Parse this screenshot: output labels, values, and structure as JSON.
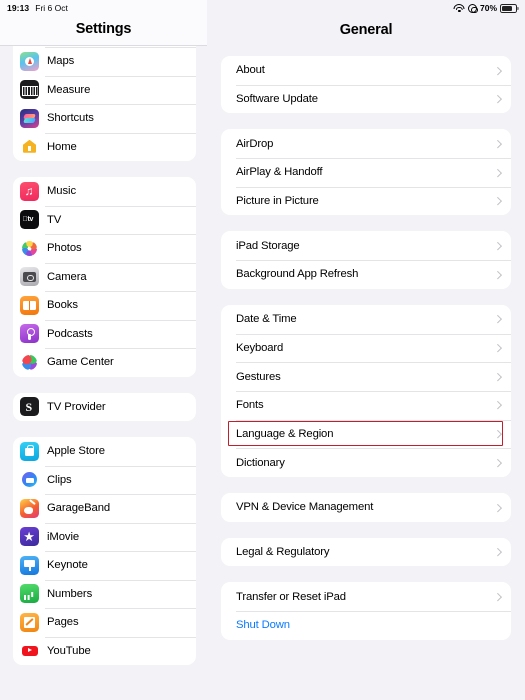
{
  "status_bar": {
    "time": "19:13",
    "date": "Fri 6 Oct",
    "wifi_icon": "wifi-icon",
    "location_icon": "location-icon",
    "battery_percent": "70%",
    "battery_icon": "battery-icon",
    "battery_level": 70
  },
  "sidebar": {
    "title": "Settings",
    "groups": [
      {
        "clipped_top": true,
        "items": [
          {
            "label": "Maps",
            "icon": "maps-app-icon",
            "icon_class": "ic-maps"
          },
          {
            "label": "Measure",
            "icon": "measure-app-icon",
            "icon_class": "ic-measure"
          },
          {
            "label": "Shortcuts",
            "icon": "shortcuts-app-icon",
            "icon_class": "ic-shortcuts"
          },
          {
            "label": "Home",
            "icon": "home-app-icon",
            "icon_class": "ic-home"
          }
        ]
      },
      {
        "clipped_top": false,
        "items": [
          {
            "label": "Music",
            "icon": "music-app-icon",
            "icon_class": "ic-music"
          },
          {
            "label": "TV",
            "icon": "tv-app-icon",
            "icon_class": "ic-tv"
          },
          {
            "label": "Photos",
            "icon": "photos-app-icon",
            "icon_class": "ic-photos"
          },
          {
            "label": "Camera",
            "icon": "camera-app-icon",
            "icon_class": "ic-camera"
          },
          {
            "label": "Books",
            "icon": "books-app-icon",
            "icon_class": "ic-books"
          },
          {
            "label": "Podcasts",
            "icon": "podcasts-app-icon",
            "icon_class": "ic-podcasts"
          },
          {
            "label": "Game Center",
            "icon": "game-center-app-icon",
            "icon_class": "ic-gamecenter"
          }
        ]
      },
      {
        "clipped_top": false,
        "items": [
          {
            "label": "TV Provider",
            "icon": "tv-provider-icon",
            "icon_class": "ic-tvprovider"
          }
        ]
      },
      {
        "clipped_top": false,
        "items": [
          {
            "label": "Apple Store",
            "icon": "apple-store-app-icon",
            "icon_class": "ic-applestore"
          },
          {
            "label": "Clips",
            "icon": "clips-app-icon",
            "icon_class": "ic-clips"
          },
          {
            "label": "GarageBand",
            "icon": "garageband-app-icon",
            "icon_class": "ic-garageband"
          },
          {
            "label": "iMovie",
            "icon": "imovie-app-icon",
            "icon_class": "ic-imovie"
          },
          {
            "label": "Keynote",
            "icon": "keynote-app-icon",
            "icon_class": "ic-keynote"
          },
          {
            "label": "Numbers",
            "icon": "numbers-app-icon",
            "icon_class": "ic-numbers"
          },
          {
            "label": "Pages",
            "icon": "pages-app-icon",
            "icon_class": "ic-pages"
          },
          {
            "label": "YouTube",
            "icon": "youtube-app-icon",
            "icon_class": "ic-youtube"
          }
        ]
      }
    ]
  },
  "detail": {
    "title": "General",
    "groups": [
      {
        "items": [
          {
            "label": "About",
            "chevron": true,
            "style": "default"
          },
          {
            "label": "Software Update",
            "chevron": true,
            "style": "default"
          }
        ]
      },
      {
        "items": [
          {
            "label": "AirDrop",
            "chevron": true,
            "style": "default"
          },
          {
            "label": "AirPlay & Handoff",
            "chevron": true,
            "style": "default"
          },
          {
            "label": "Picture in Picture",
            "chevron": true,
            "style": "default"
          }
        ]
      },
      {
        "items": [
          {
            "label": "iPad Storage",
            "chevron": true,
            "style": "default"
          },
          {
            "label": "Background App Refresh",
            "chevron": true,
            "style": "default"
          }
        ]
      },
      {
        "items": [
          {
            "label": "Date & Time",
            "chevron": true,
            "style": "default"
          },
          {
            "label": "Keyboard",
            "chevron": true,
            "style": "default"
          },
          {
            "label": "Gestures",
            "chevron": true,
            "style": "default"
          },
          {
            "label": "Fonts",
            "chevron": true,
            "style": "default"
          },
          {
            "label": "Language & Region",
            "chevron": true,
            "style": "default",
            "highlighted": true
          },
          {
            "label": "Dictionary",
            "chevron": true,
            "style": "default"
          }
        ]
      },
      {
        "items": [
          {
            "label": "VPN & Device Management",
            "chevron": true,
            "style": "default"
          }
        ]
      },
      {
        "items": [
          {
            "label": "Legal & Regulatory",
            "chevron": true,
            "style": "default"
          }
        ]
      },
      {
        "items": [
          {
            "label": "Transfer or Reset iPad",
            "chevron": true,
            "style": "default"
          },
          {
            "label": "Shut Down",
            "chevron": false,
            "style": "link"
          }
        ]
      }
    ]
  },
  "annotation": {
    "target_label": "Language & Region",
    "box_color": "#c0202c"
  }
}
